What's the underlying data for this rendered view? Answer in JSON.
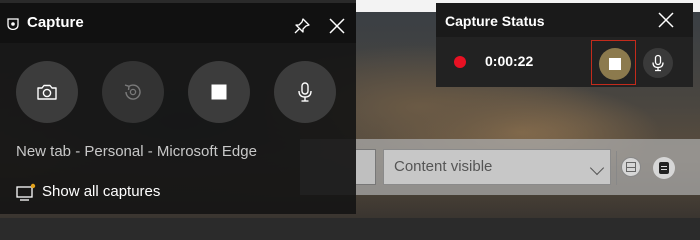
{
  "background": {
    "dropdown_value": "Content visible"
  },
  "capture_panel": {
    "title": "Capture",
    "buttons": {
      "screenshot": "camera-icon",
      "record_last": "record-last-30-icon",
      "stop": "stop-icon",
      "microphone": "microphone-icon"
    },
    "source": "New tab - Personal - Microsoft Edge",
    "show_all_label": "Show all captures"
  },
  "status_panel": {
    "title": "Capture Status",
    "timer": "0:00:22",
    "recording_color": "#e81123",
    "stop_accent": "#8c7a4d"
  }
}
